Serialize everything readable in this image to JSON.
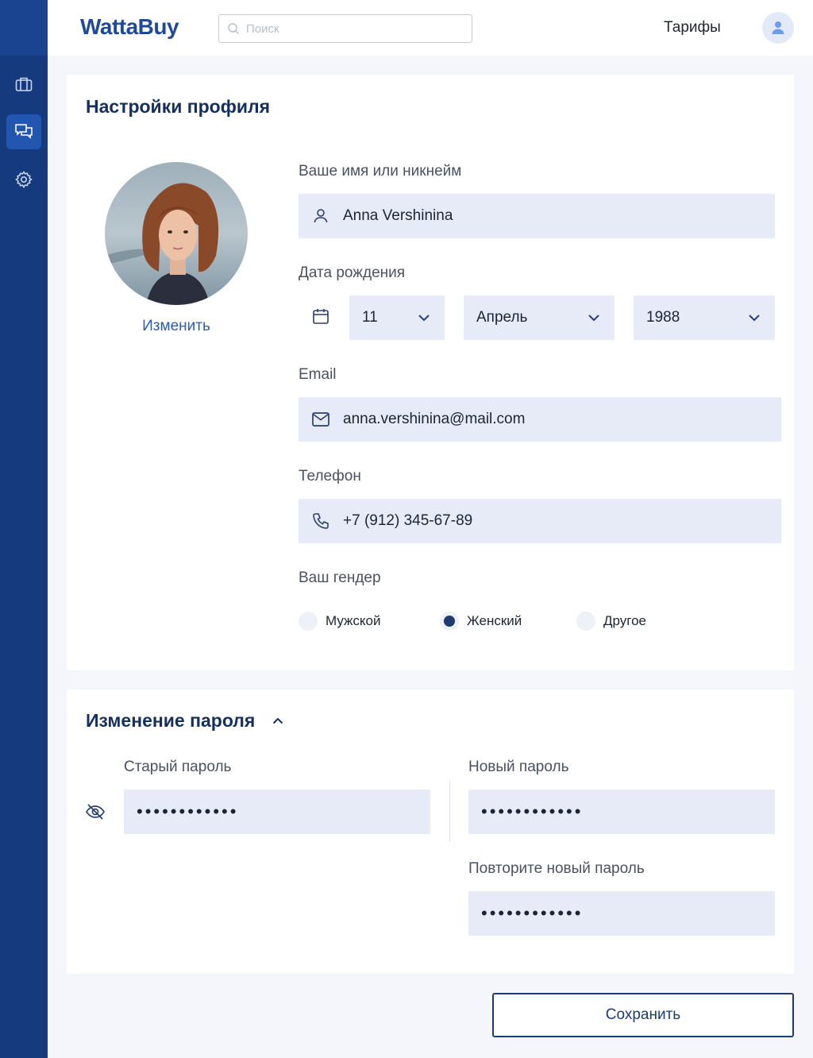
{
  "app": {
    "logo": "WattaBuy"
  },
  "header": {
    "search_placeholder": "Поиск",
    "tariffs_label": "Тарифы"
  },
  "sidebar": {
    "items": [
      {
        "icon": "briefcase-icon",
        "active": false
      },
      {
        "icon": "chat-icon",
        "active": true
      },
      {
        "icon": "gear-icon",
        "active": false
      }
    ]
  },
  "profile": {
    "title": "Настройки профиля",
    "change_photo_label": "Изменить",
    "name_label": "Ваше имя или никнейм",
    "name_value": "Anna Vershinina",
    "birth_label": "Дата рождения",
    "birth_day": "11",
    "birth_month": "Апрель",
    "birth_year": "1988",
    "email_label": "Email",
    "email_value": "anna.vershinina@mail.com",
    "phone_label": "Телефон",
    "phone_value": "+7 (912) 345-67-89",
    "gender_label": "Ваш гендер",
    "gender_options": [
      "Мужской",
      "Женский",
      "Другое"
    ],
    "gender_selected": "Женский"
  },
  "password": {
    "title": "Изменение пароля",
    "old_label": "Старый пароль",
    "old_value": "••••••••••••",
    "new_label": "Новый пароль",
    "new_value": "••••••••••••",
    "repeat_label": "Повторите новый пароль",
    "repeat_value": "••••••••••••"
  },
  "actions": {
    "save_label": "Сохранить"
  },
  "colors": {
    "sidebar": "#163a7e",
    "accent": "#1f4a9a",
    "field_bg": "#e7ebf7",
    "title": "#15305f"
  }
}
